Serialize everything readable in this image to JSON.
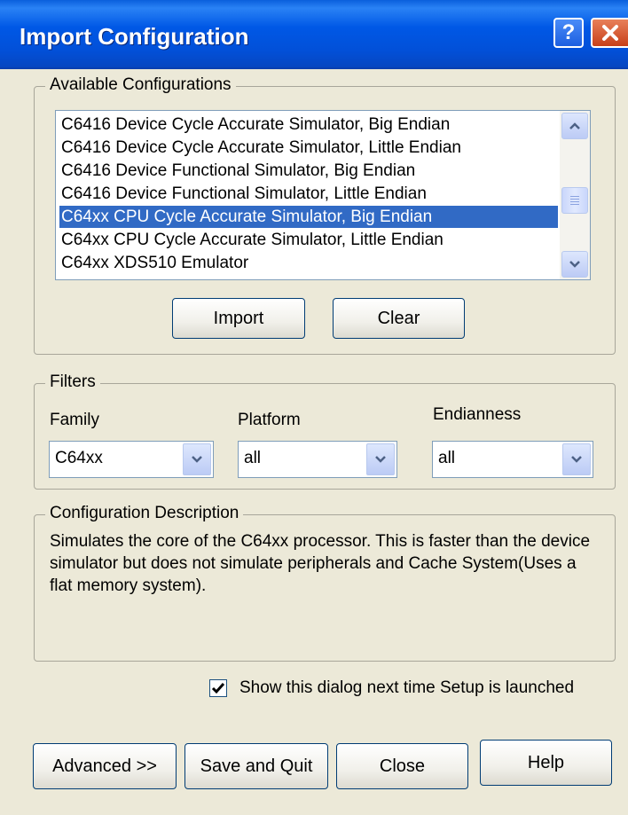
{
  "window": {
    "title": "Import Configuration"
  },
  "available": {
    "legend": "Available Configurations",
    "items": [
      "C6416 Device Cycle Accurate Simulator, Big Endian",
      "C6416 Device Cycle Accurate Simulator, Little Endian",
      "C6416 Device Functional Simulator, Big Endian",
      "C6416 Device Functional Simulator, Little Endian",
      "C64xx CPU Cycle Accurate Simulator, Big Endian",
      "C64xx CPU Cycle Accurate Simulator, Little Endian",
      "C64xx XDS510 Emulator"
    ],
    "selected_index": 4,
    "import_label": "Import",
    "clear_label": "Clear"
  },
  "filters": {
    "legend": "Filters",
    "family": {
      "label": "Family",
      "value": "C64xx"
    },
    "platform": {
      "label": "Platform",
      "value": "all"
    },
    "endianness": {
      "label": "Endianness",
      "value": "all"
    }
  },
  "description": {
    "legend": "Configuration Description",
    "text": "Simulates the core of the C64xx processor. This is faster than the device simulator but does not simulate peripherals and Cache System(Uses a flat memory system)."
  },
  "show_dialog": {
    "label": "Show this dialog next time Setup is launched",
    "checked": true
  },
  "footer": {
    "advanced": "Advanced >>",
    "save_quit": "Save and Quit",
    "close": "Close",
    "help": "Help"
  },
  "colors": {
    "titlebar": "#0058e6",
    "selection": "#316ac5",
    "dialog_bg": "#ece9d8"
  }
}
